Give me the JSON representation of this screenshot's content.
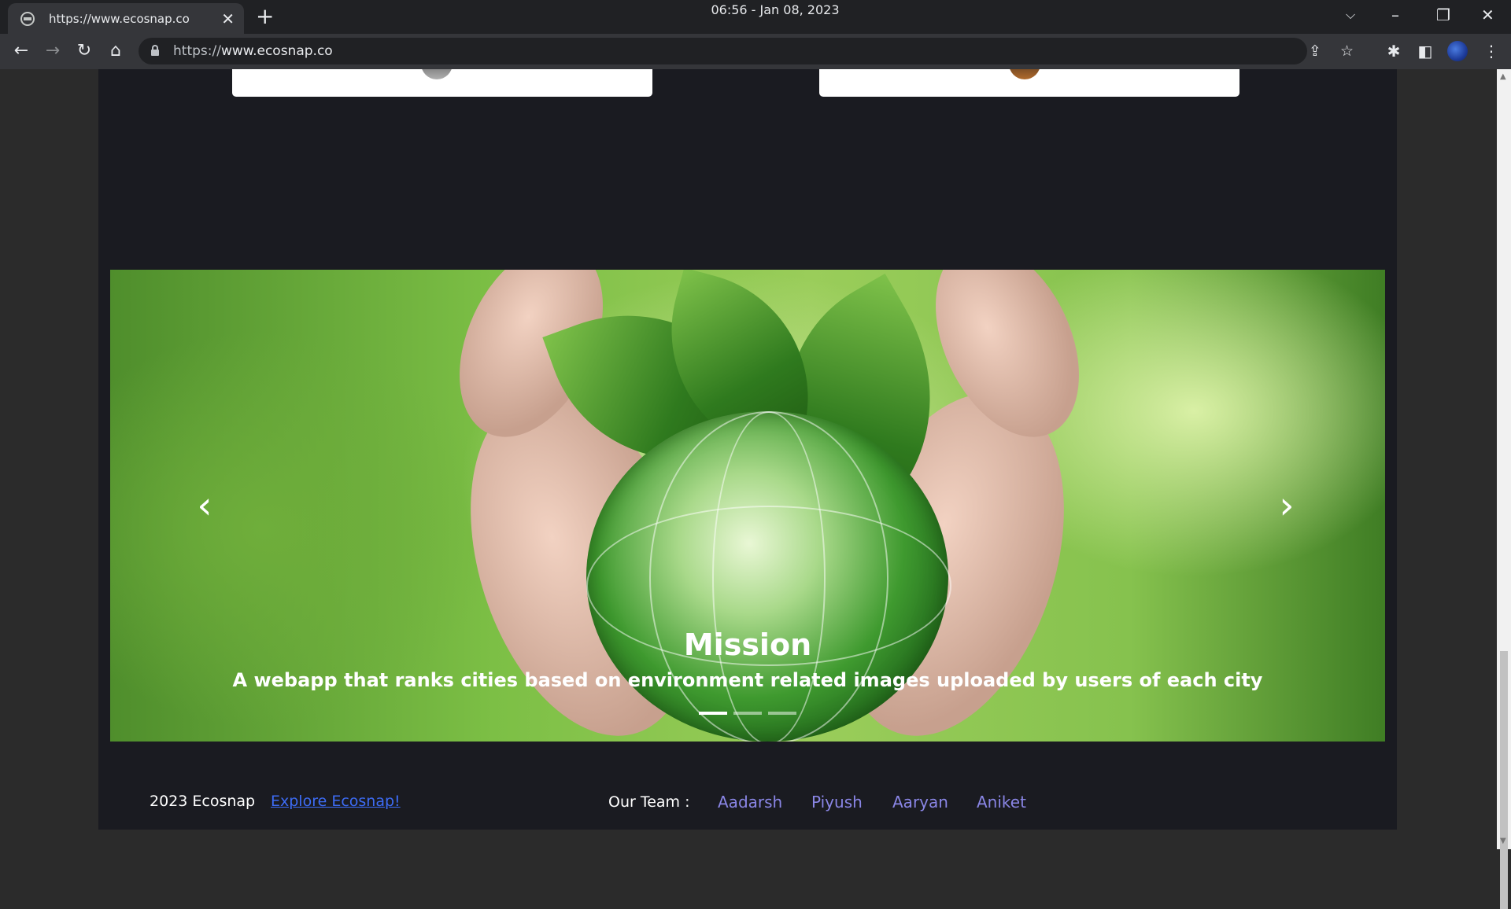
{
  "browser": {
    "tab_title": "https://www.ecosnap.co",
    "clock": "06:56 - Jan 08, 2023",
    "url_scheme": "https://",
    "url_host": "www.ecosnap.co",
    "icons": [
      "globe-icon",
      "close-icon",
      "plus-icon",
      "chevron-down-icon",
      "minimize-icon",
      "restore-icon",
      "close-icon",
      "back-icon",
      "forward-icon",
      "reload-icon",
      "home-icon",
      "lock-icon",
      "share-icon",
      "star-icon",
      "puzzle-icon",
      "sidebar-icon",
      "profile-icon",
      "kebab-menu-icon"
    ]
  },
  "carousel": {
    "title": "Mission",
    "text": "A webapp that ranks cities based on environment related images uploaded by users of each city",
    "slide_count": 3,
    "active_slide": 1
  },
  "footer": {
    "copyright": "2023 Ecosnap",
    "explore_link": "Explore Ecosnap!",
    "team_label": "Our Team :",
    "team": [
      "Aadarsh",
      "Piyush",
      "Aaryan",
      "Aniket"
    ]
  },
  "colors": {
    "page_bg": "#1a1b21",
    "link_blue": "#3d6cf5",
    "team_purple": "#8a86e6"
  }
}
